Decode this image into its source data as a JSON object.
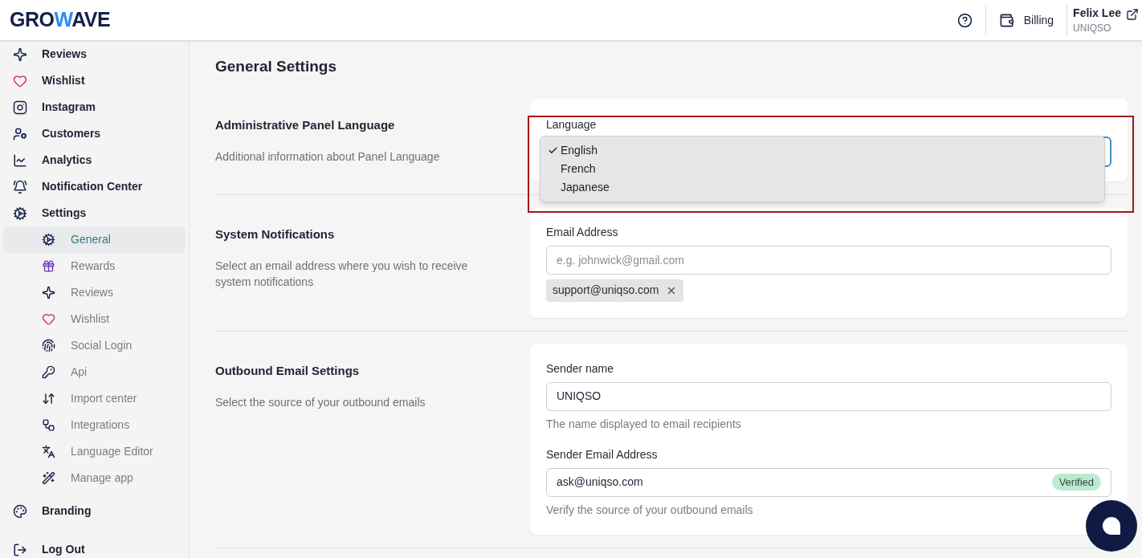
{
  "header": {
    "logo": {
      "before": "GRO",
      "accent": "W",
      "after": "AVE"
    },
    "billing": "Billing",
    "user": {
      "name": "Felix Lee",
      "company": "UNIQSO"
    }
  },
  "sidebar": {
    "items": [
      {
        "label": "Reviews",
        "selected": false
      },
      {
        "label": "Wishlist",
        "selected": false
      },
      {
        "label": "Instagram",
        "selected": false
      },
      {
        "label": "Customers",
        "selected": false
      },
      {
        "label": "Analytics",
        "selected": false
      },
      {
        "label": "Notification Center",
        "selected": false
      },
      {
        "label": "Settings",
        "selected": false,
        "expanded": true,
        "children": [
          {
            "label": "General",
            "selected": true
          },
          {
            "label": "Rewards",
            "selected": false
          },
          {
            "label": "Reviews",
            "selected": false
          },
          {
            "label": "Wishlist",
            "selected": false
          },
          {
            "label": "Social Login",
            "selected": false
          },
          {
            "label": "Api",
            "selected": false
          },
          {
            "label": "Import center",
            "selected": false
          },
          {
            "label": "Integrations",
            "selected": false
          },
          {
            "label": "Language Editor",
            "selected": false
          },
          {
            "label": "Manage app",
            "selected": false
          }
        ]
      },
      {
        "label": "Branding",
        "selected": false
      },
      {
        "label": "Log Out",
        "selected": false
      }
    ]
  },
  "page": {
    "title": "General Settings",
    "sections": [
      {
        "kind": "language",
        "title": "Administrative Panel Language",
        "description": "Additional information about Panel Language",
        "label": "Language",
        "dropdown": {
          "open": true,
          "options": [
            {
              "label": "English",
              "selected": true
            },
            {
              "label": "French",
              "selected": false
            },
            {
              "label": "Japanese",
              "selected": false
            }
          ]
        }
      },
      {
        "kind": "email",
        "title": "System Notifications",
        "description": "Select an email address where you wish to receive system notifications",
        "label": "Email Address",
        "placeholder": "e.g. johnwick@gmail.com",
        "tags": [
          "support@uniqso.com"
        ]
      },
      {
        "kind": "outbound",
        "title": "Outbound Email Settings",
        "description": "Select the source of your outbound emails",
        "fields": [
          {
            "label": "Sender name",
            "value": "UNIQSO",
            "help": "The name displayed to email recipients"
          },
          {
            "label": "Sender Email Address",
            "value": "ask@uniqso.com",
            "badge": "Verified",
            "help": "Verify the source of your outbound emails"
          }
        ]
      }
    ]
  }
}
